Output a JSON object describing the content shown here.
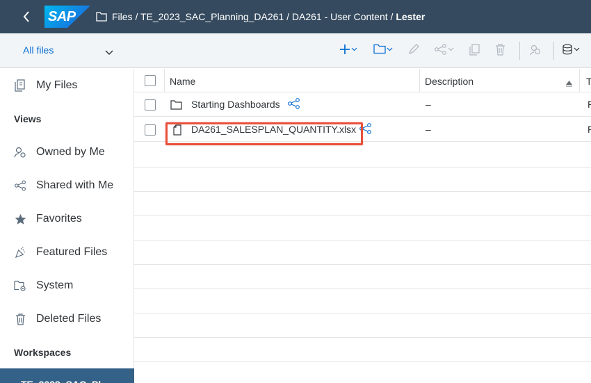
{
  "shell": {
    "logo_text": "SAP",
    "breadcrumb_path": "Files / TE_2023_SAC_Planning_DA261 / DA261 - User Content / ",
    "breadcrumb_current": "Lester"
  },
  "toolbar": {
    "filter_label": "All files",
    "icons": [
      "add-icon",
      "new-folder-icon",
      "edit-icon",
      "share-icon",
      "copy-icon",
      "delete-icon",
      "share-settings-icon",
      "data-source-icon"
    ]
  },
  "sidebar": {
    "my_files": "My Files",
    "views_heading": "Views",
    "views": [
      {
        "label": "Owned by Me",
        "icon": "owner-icon"
      },
      {
        "label": "Shared with Me",
        "icon": "share-icon"
      },
      {
        "label": "Favorites",
        "icon": "star-icon"
      },
      {
        "label": "Featured Files",
        "icon": "featured-icon"
      },
      {
        "label": "System",
        "icon": "system-folder-icon"
      },
      {
        "label": "Deleted Files",
        "icon": "trash-icon"
      }
    ],
    "workspaces_heading": "Workspaces",
    "workspace_item": "TE_2023_SAC_Pl"
  },
  "table": {
    "columns": [
      "Name",
      "Description",
      "T"
    ],
    "rows": [
      {
        "name": "Starting Dashboards",
        "description": "–",
        "type": "F",
        "kind": "folder"
      },
      {
        "name": "DA261_SALESPLAN_QUANTITY.xlsx",
        "description": "–",
        "type": "F",
        "kind": "file"
      }
    ]
  },
  "colors": {
    "shell_bg": "#354a5f",
    "accent": "#0a6ed1",
    "highlight": "#e8503a"
  }
}
